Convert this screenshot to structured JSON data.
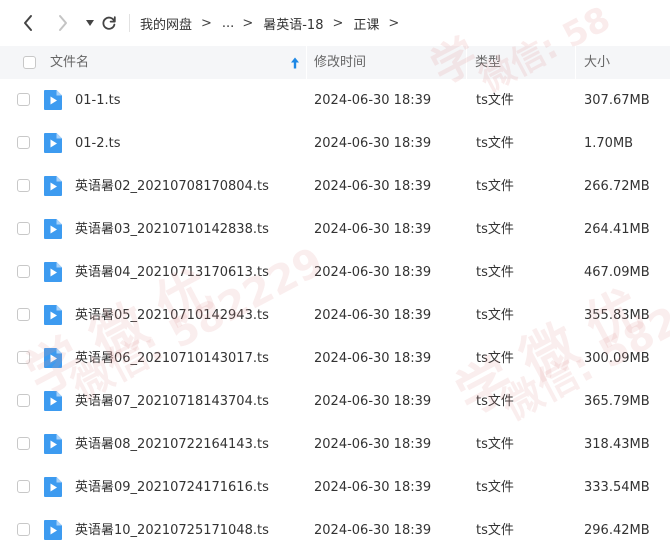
{
  "toolbar": {
    "back_icon": "chevron-left-icon",
    "forward_icon": "chevron-right-icon",
    "history_icon": "caret-down-icon",
    "refresh_icon": "refresh-icon"
  },
  "breadcrumb": {
    "root": "我的网盘",
    "ellipsis": "...",
    "folder": "暑英语-18",
    "current": "正课",
    "separator": ">"
  },
  "header": {
    "name": "文件名",
    "time": "修改时间",
    "type": "类型",
    "size": "大小",
    "sort_icon": "sort-ascending-arrow-icon"
  },
  "files": [
    {
      "name": "01-1.ts",
      "time": "2024-06-30 18:39",
      "type": "ts文件",
      "size": "307.67MB"
    },
    {
      "name": "01-2.ts",
      "time": "2024-06-30 18:39",
      "type": "ts文件",
      "size": "1.70MB"
    },
    {
      "name": "英语暑02_20210708170804.ts",
      "time": "2024-06-30 18:39",
      "type": "ts文件",
      "size": "266.72MB"
    },
    {
      "name": "英语暑03_20210710142838.ts",
      "time": "2024-06-30 18:39",
      "type": "ts文件",
      "size": "264.41MB"
    },
    {
      "name": "英语暑04_20210713170613.ts",
      "time": "2024-06-30 18:39",
      "type": "ts文件",
      "size": "467.09MB"
    },
    {
      "name": "英语暑05_20210710142943.ts",
      "time": "2024-06-30 18:39",
      "type": "ts文件",
      "size": "355.83MB"
    },
    {
      "name": "英语暑06_20210710143017.ts",
      "time": "2024-06-30 18:39",
      "type": "ts文件",
      "size": "300.09MB"
    },
    {
      "name": "英语暑07_20210718143704.ts",
      "time": "2024-06-30 18:39",
      "type": "ts文件",
      "size": "365.79MB"
    },
    {
      "name": "英语暑08_20210722164143.ts",
      "time": "2024-06-30 18:39",
      "type": "ts文件",
      "size": "318.43MB"
    },
    {
      "name": "英语暑09_20210724171616.ts",
      "time": "2024-06-30 18:39",
      "type": "ts文件",
      "size": "333.54MB"
    },
    {
      "name": "英语暑10_20210725171048.ts",
      "time": "2024-06-30 18:39",
      "type": "ts文件",
      "size": "296.42MB"
    }
  ],
  "file_icon": "video-file-icon",
  "watermark": {
    "line1": "学",
    "line2": "微信: 58",
    "line3": "学 微 优",
    "line4": "微信: 582229"
  },
  "colors": {
    "accent": "#1e88e5",
    "file_icon": "#3d9bf0",
    "header_bg": "#f5f6f8",
    "watermark": "#e8b2b2"
  }
}
